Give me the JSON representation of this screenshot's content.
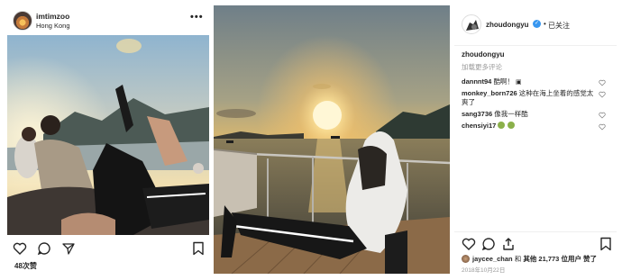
{
  "left_post": {
    "username": "imtimzoo",
    "location": "Hong Kong",
    "more_label": "•••",
    "likes": "48次赞"
  },
  "right_post": {
    "username": "zhoudongyu",
    "follow_separator": "•",
    "follow_label": "已关注",
    "caption_username": "zhoudongyu",
    "load_more_label": "加载更多评论",
    "comments": [
      {
        "user": "dannnt94",
        "text": "酷啊！"
      },
      {
        "user": "monkey_born726",
        "text": "这种在海上坐着的感觉太爽了"
      },
      {
        "user": "sang3736",
        "text": "像我一样酷"
      },
      {
        "user": "chensiyi17",
        "text": ""
      }
    ],
    "likes_user": "jaycee_chan",
    "likes_and": "和",
    "likes_others": "其他",
    "likes_count": "21,773",
    "likes_suffix": "位用户 赞了",
    "date": "2018年10月22日"
  },
  "icons": {
    "heart": "heart-icon",
    "comment": "comment-icon",
    "share": "share-icon",
    "bookmark": "bookmark-icon",
    "verified": "verified-badge-icon"
  },
  "colors": {
    "text": "#262626",
    "muted": "#999999",
    "verified": "#3897f0"
  }
}
